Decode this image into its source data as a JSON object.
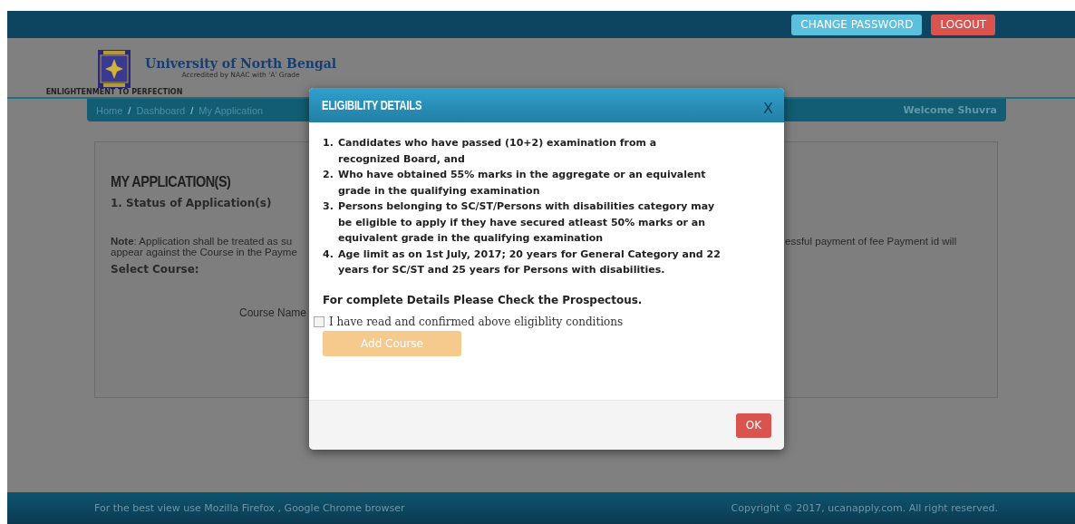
{
  "top_bar": {
    "buttons": [
      {
        "label": "CHANGE PASSWORD",
        "kind": "info"
      },
      {
        "label": "LOGOUT",
        "kind": "danger"
      }
    ]
  },
  "header": {
    "title": "University of North Bengal",
    "subtitle": "Accredited by NAAC with 'A' Grade",
    "motto": "ENLIGHTENMENT TO PERFECTION"
  },
  "breadcrumb": {
    "items": [
      "Home",
      "Dashboard",
      "My Application"
    ],
    "separator": "/",
    "welcome": "Welcome Shuvra"
  },
  "card": {
    "heading": "MY APPLICATION(S)",
    "subheading": "1. Status of Application(s)",
    "note_label": "Note",
    "note_left": [
      ": Application shall be treated as su",
      "appear against the Course in the Payme"
    ],
    "note_right": "essful payment of fee Payment id will",
    "select_label": "Select Course:",
    "course_label": "Course Name"
  },
  "modal": {
    "title": "ELIGIBILITY DETAILS",
    "close": "X",
    "items": [
      {
        "number": "1.",
        "text": "Candidates who have passed (10+2) examination from a recognized Board, and"
      },
      {
        "number": "2.",
        "text": "Who have obtained 55% marks in the aggregate or an equivalent grade in the qualifying examination"
      },
      {
        "number": "3.",
        "text": "Persons belonging to SC/ST/Persons with disabilities category may be eligible to apply if they have secured atleast 50% marks or an equivalent grade in the qualifying examination"
      },
      {
        "number": "4.",
        "text": "Age limit as on 1st July, 2017; 20 years for General Category and 22 years for SC/ST and 25 years for Persons with disabilities."
      }
    ],
    "footnote": "For complete Details Please Check the Prospectous.",
    "confirm": {
      "label": "I have read and confirmed above eligiblity conditions",
      "checked": false
    },
    "add_button": {
      "label": "Add Course",
      "disabled": true
    },
    "ok_button": "OK"
  },
  "footer": {
    "left": "For the best view use Mozilla Firefox , Google Chrome browser",
    "right": "Copyright © 2017, ucanapply.com. All right reserved."
  }
}
